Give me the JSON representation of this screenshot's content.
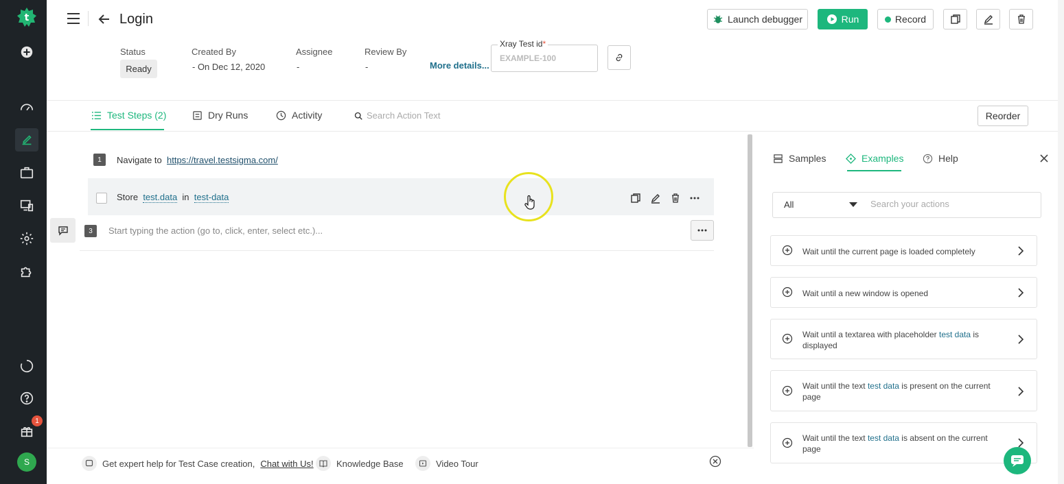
{
  "sidebar": {
    "badge_count": "1",
    "avatar_initial": "S"
  },
  "header": {
    "title": "Login",
    "buttons": {
      "debugger": "Launch debugger",
      "run": "Run",
      "record": "Record"
    }
  },
  "meta": {
    "status_label": "Status",
    "status_value": "Ready",
    "created_by_label": "Created By",
    "created_by_value": "- On Dec 12, 2020",
    "assignee_label": "Assignee",
    "assignee_value": "-",
    "review_by_label": "Review By",
    "review_by_value": "-",
    "more_details": "More details...",
    "xray_label": "Xray Test id",
    "xray_required": "*",
    "xray_placeholder": "EXAMPLE-100"
  },
  "tabs": {
    "steps": "Test Steps (2)",
    "dry_runs": "Dry Runs",
    "activity": "Activity",
    "search_placeholder": "Search Action Text",
    "reorder": "Reorder"
  },
  "steps": [
    {
      "num": "1",
      "verb": "Navigate to",
      "url": "https://travel.testsigma.com/"
    },
    {
      "store": "Store",
      "data": "test.data",
      "in": "in",
      "target": "test-data"
    },
    {
      "num": "3",
      "placeholder": "Start typing the action (go to, click, enter, select etc.)..."
    }
  ],
  "right_panel": {
    "tabs": {
      "samples": "Samples",
      "examples": "Examples",
      "help": "Help"
    },
    "filter_value": "All",
    "search_placeholder": "Search your actions",
    "cards": [
      {
        "pre": "Wait until the current page is loaded completely",
        "data": "",
        "post": ""
      },
      {
        "pre": "Wait until a new window is opened",
        "data": "",
        "post": ""
      },
      {
        "pre": "Wait until a textarea with placeholder ",
        "data": "test data",
        "post": " is displayed"
      },
      {
        "pre": "Wait until the text ",
        "data": "test data",
        "post": " is present on the current page"
      },
      {
        "pre": "Wait until the text ",
        "data": "test data",
        "post": " is absent on the current page"
      }
    ]
  },
  "footer": {
    "help_text": "Get expert help for Test Case creation,",
    "chat_link": "Chat with Us!",
    "knowledge_base": "Knowledge Base",
    "video_tour": "Video Tour"
  },
  "colors": {
    "accent": "#1db77d",
    "sidebar_bg": "#1e2327",
    "link": "#1f6f8b"
  }
}
